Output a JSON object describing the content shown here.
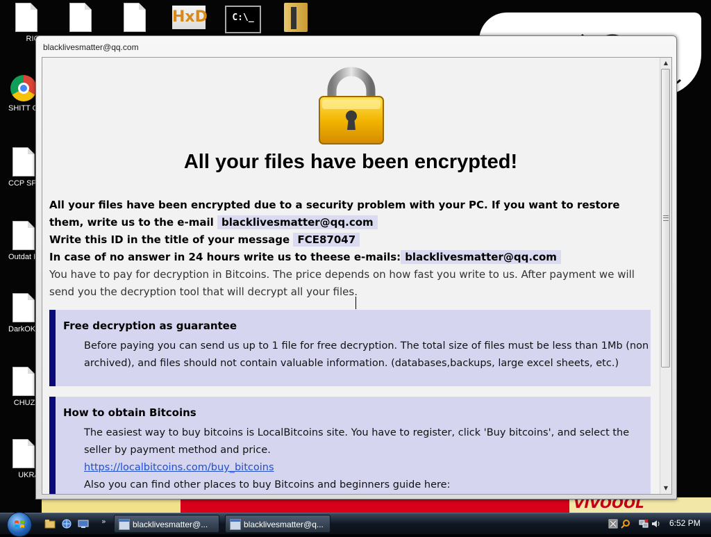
{
  "desktop": {
    "icons": [
      {
        "label": "RIGB'"
      },
      {
        "label": "SHITT OUTDA"
      },
      {
        "label": "CCP SPYWA"
      },
      {
        "label": "Outdat IDM Crac"
      },
      {
        "label": "DarkOK V Game"
      },
      {
        "label": "CHUZZLI"
      },
      {
        "label": "UKRAI"
      }
    ],
    "top_icons": [
      {
        "name": "document",
        "icon": "document-icon"
      },
      {
        "name": "document",
        "icon": "document-icon"
      },
      {
        "name": "document",
        "icon": "document-icon"
      },
      {
        "name": "HxD",
        "icon": "hxd-icon"
      },
      {
        "name": "cmd",
        "icon": "cmd-icon"
      },
      {
        "name": "winrar",
        "icon": "archive-icon"
      }
    ],
    "hxd_text": "HxD",
    "cmd_text": "C:\\_",
    "wallpaper_text": "VIVOOOL"
  },
  "window": {
    "title": "blacklivesmatter@qq.com",
    "headline": "All your files have been encrypted!",
    "para1_text": "All your files have been encrypted due to a security problem with your PC. If you want to restore them, write us to the e-mail",
    "email": "blacklivesmatter@qq.com",
    "id_label": "Write this ID in the title of your message",
    "id_value": "FCE87047",
    "no_answer_label": "In case of no answer in 24 hours write us to theese e-mails:",
    "no_answer_email": "blacklivesmatter@qq.com",
    "payment_text": "You have to pay for decryption in Bitcoins. The price depends on how fast you write to us. After payment we will send you the decryption tool that will decrypt all your files.",
    "free_box": {
      "title": "Free decryption as guarantee",
      "body": "Before paying you can send us up to 1 file for free decryption. The total size of files must be less than 1Mb (non archived), and files should not contain valuable information. (databases,backups, large excel sheets, etc.)"
    },
    "buy_box": {
      "title": "How to obtain Bitcoins",
      "body": "The easiest way to buy bitcoins is LocalBitcoins site. You have to register, click 'Buy bitcoins', and select the seller by payment method and price.",
      "link": "https://localbitcoins.com/buy_bitcoins",
      "more": "Also you can find other places to buy Bitcoins and beginners guide here:"
    }
  },
  "taskbar": {
    "show_more": "»",
    "buttons": [
      {
        "label": "blacklivesmatter@..."
      },
      {
        "label": "blacklivesmatter@q..."
      }
    ],
    "clock": "6:52 PM"
  },
  "colors": {
    "box_bg": "#d5d5f0",
    "box_border": "#0a0a78",
    "highlight": "#dadaf0",
    "link": "#1f4fcc",
    "lock_gold": "#f2b600"
  }
}
